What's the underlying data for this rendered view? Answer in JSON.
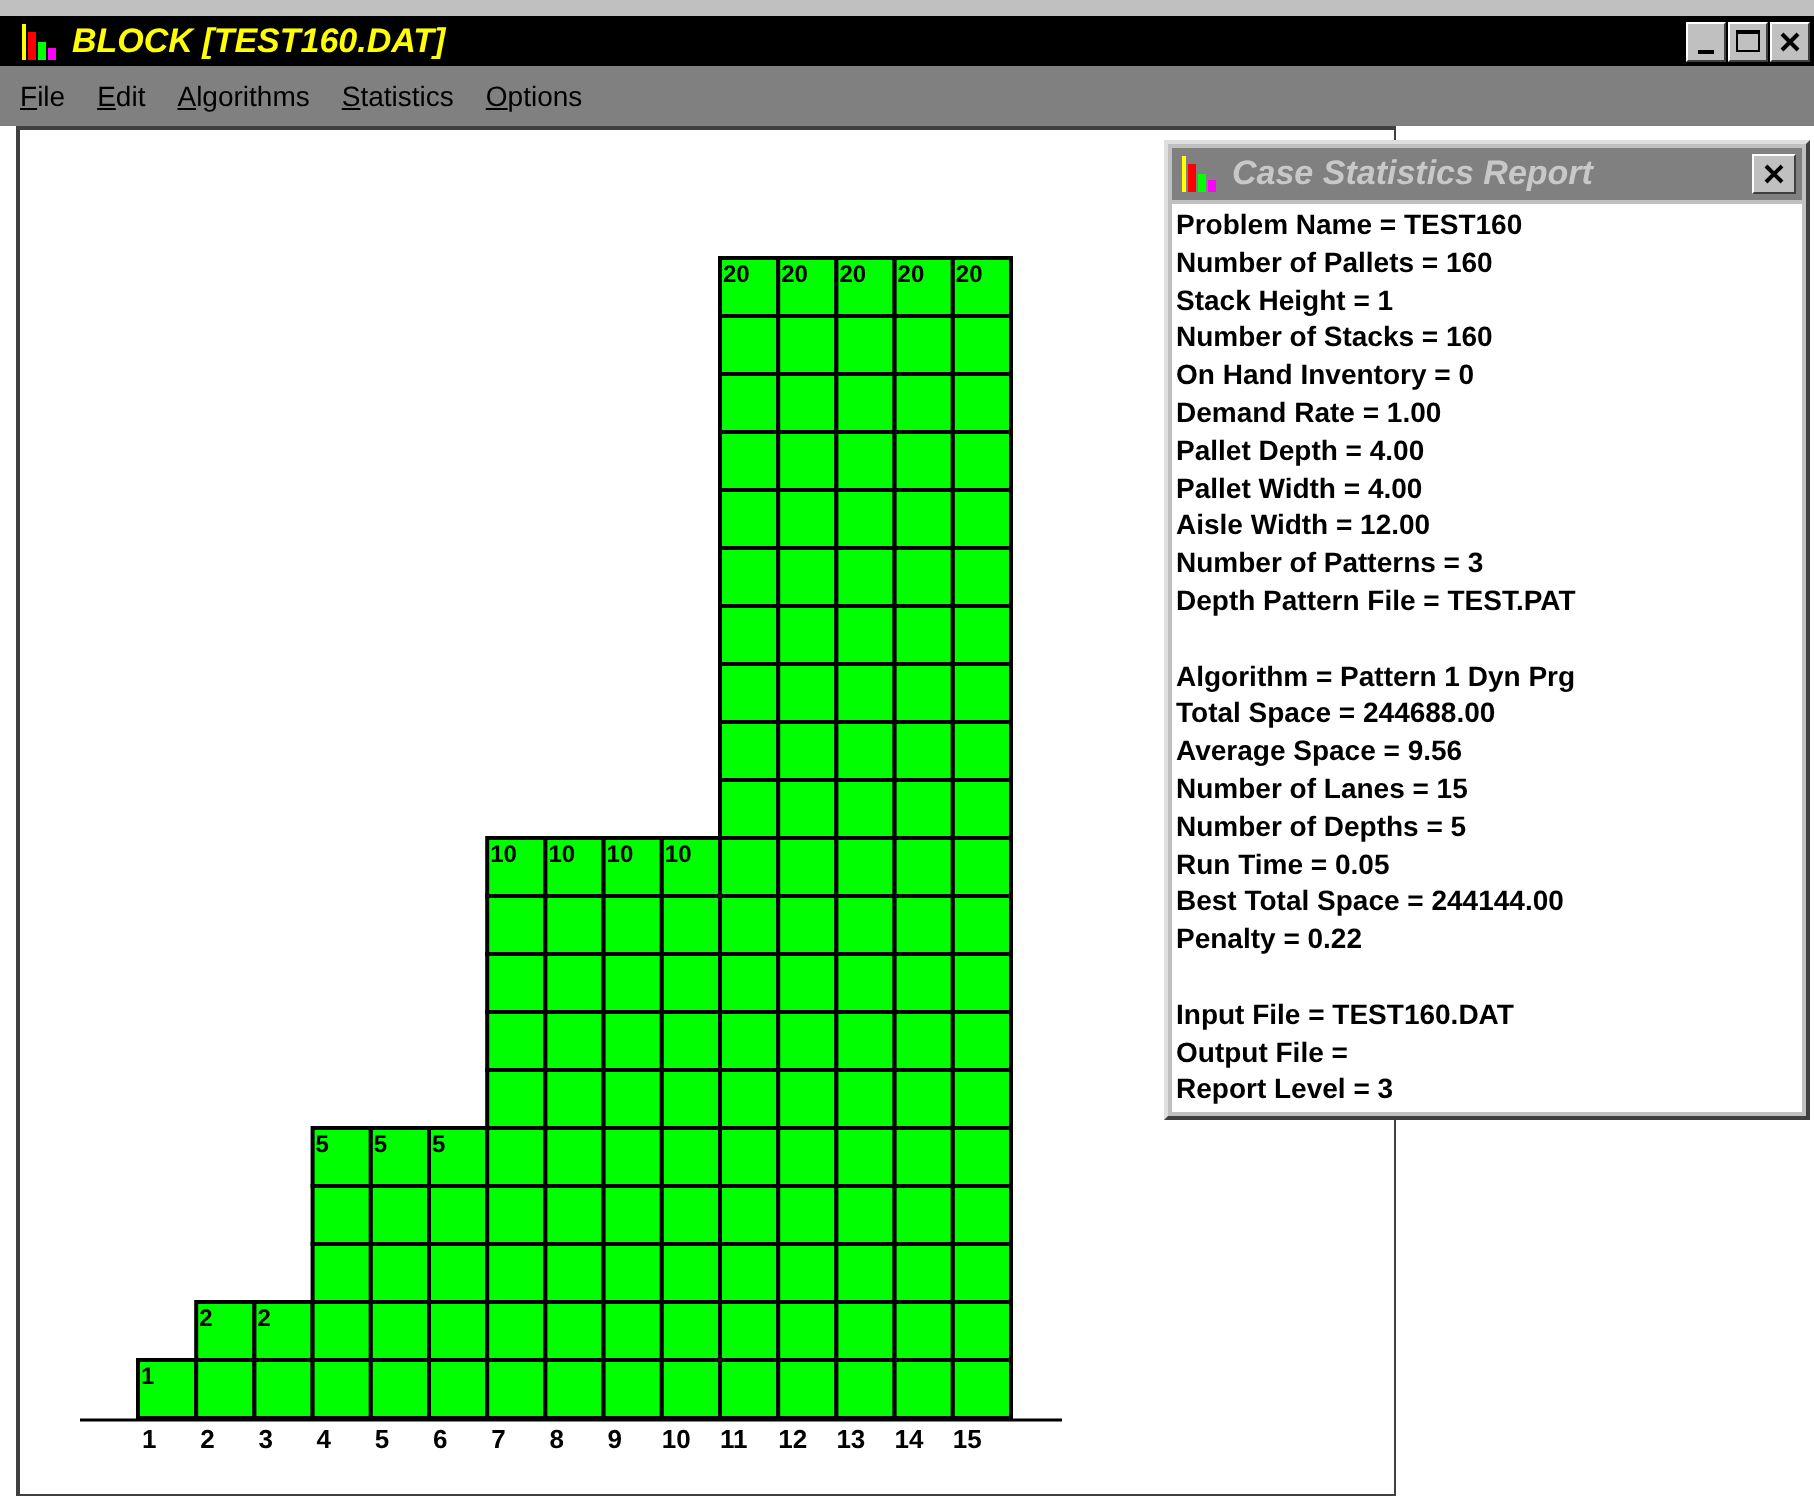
{
  "window": {
    "title": "BLOCK [TEST160.DAT]"
  },
  "menu": [
    "File",
    "Edit",
    "Algorithms",
    "Statistics",
    "Options"
  ],
  "lanes": [
    {
      "label": "1",
      "depth": "1"
    },
    {
      "label": "2",
      "depth": "2"
    },
    {
      "label": "3",
      "depth": "2"
    },
    {
      "label": "4",
      "depth": "5"
    },
    {
      "label": "5",
      "depth": "5"
    },
    {
      "label": "6",
      "depth": "5"
    },
    {
      "label": "7",
      "depth": "10"
    },
    {
      "label": "8",
      "depth": "10"
    },
    {
      "label": "9",
      "depth": "10"
    },
    {
      "label": "10",
      "depth": "10"
    },
    {
      "label": "11",
      "depth": "20"
    },
    {
      "label": "12",
      "depth": "20"
    },
    {
      "label": "13",
      "depth": "20"
    },
    {
      "label": "14",
      "depth": "20"
    },
    {
      "label": "15",
      "depth": "20"
    }
  ],
  "report": {
    "title": "Case Statistics Report",
    "sections": [
      [
        "Problem Name = TEST160",
        "Number of Pallets = 160",
        "Stack Height = 1",
        "Number of Stacks = 160",
        "On Hand Inventory = 0",
        "Demand Rate = 1.00",
        "Pallet Depth = 4.00",
        "Pallet Width = 4.00",
        "Aisle Width = 12.00",
        "Number of Patterns = 3",
        "Depth Pattern File = TEST.PAT"
      ],
      [
        "Algorithm = Pattern 1 Dyn Prg",
        "Total Space = 244688.00",
        "Average Space = 9.56",
        "Number of Lanes = 15",
        "Number of Depths = 5",
        "Run Time = 0.05",
        "Best Total Space = 244144.00",
        "Penalty = 0.22"
      ],
      [
        "Input File = TEST160.DAT",
        "Output File =",
        "Report Level = 3"
      ]
    ]
  }
}
